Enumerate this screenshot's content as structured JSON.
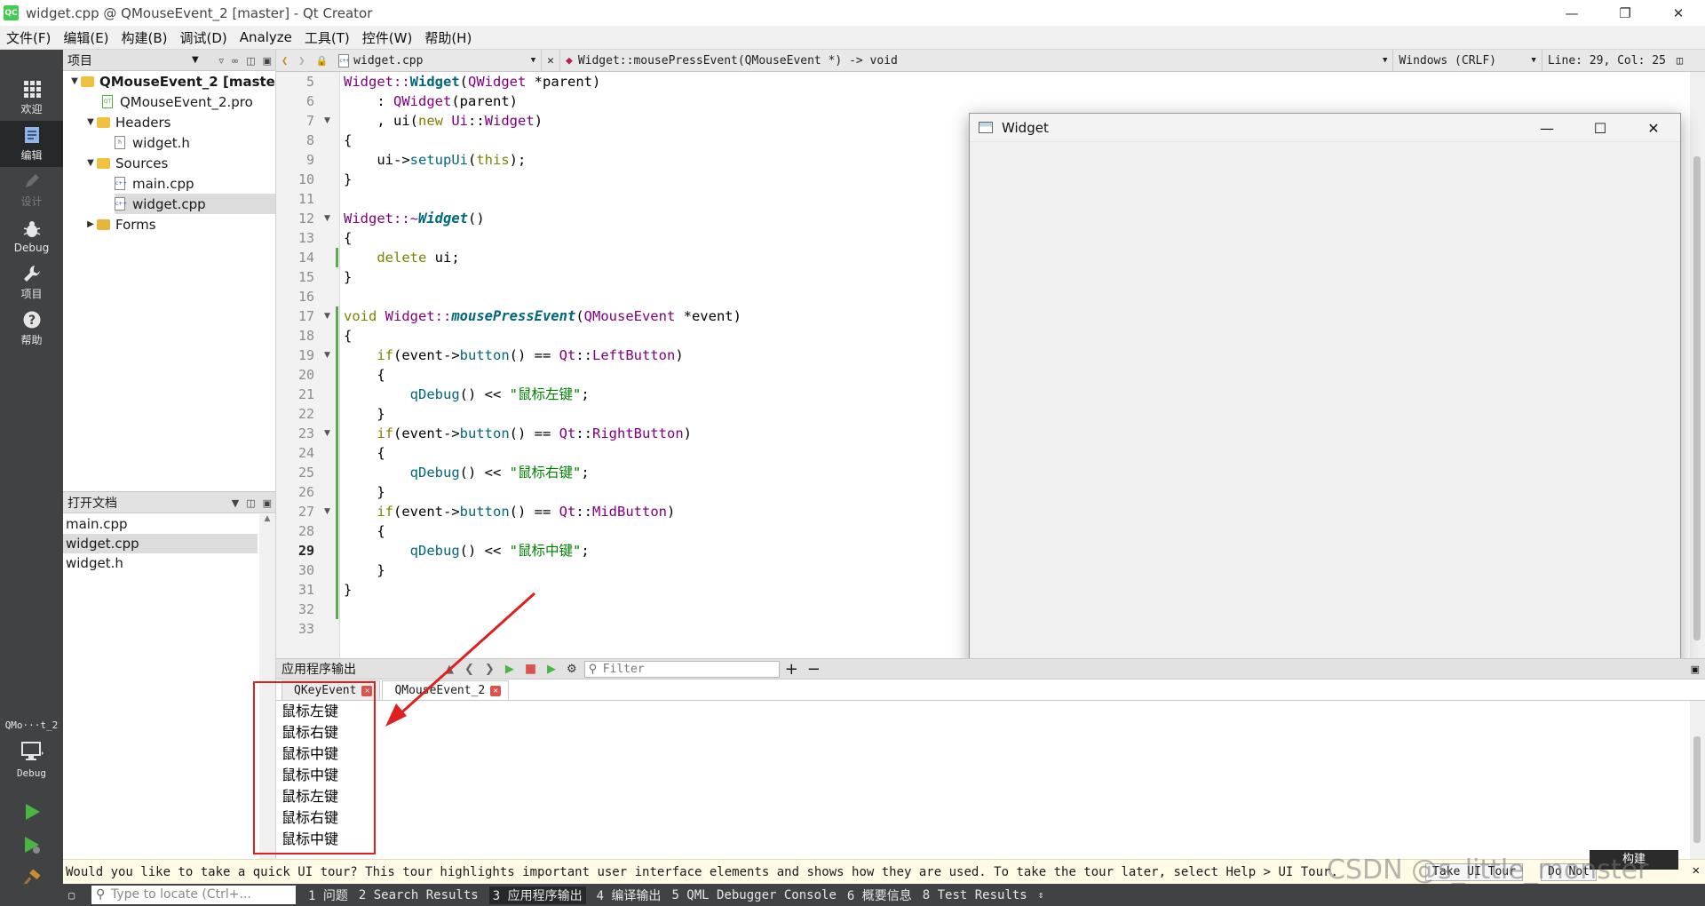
{
  "window": {
    "title": "widget.cpp @ QMouseEvent_2 [master] - Qt Creator",
    "logo": "QC"
  },
  "menu": [
    "文件(F)",
    "编辑(E)",
    "构建(B)",
    "调试(D)",
    "Analyze",
    "工具(T)",
    "控件(W)",
    "帮助(H)"
  ],
  "modes": [
    {
      "label": "欢迎",
      "icon": "grid-icon"
    },
    {
      "label": "编辑",
      "icon": "edit-icon"
    },
    {
      "label": "设计",
      "icon": "pencil-icon"
    },
    {
      "label": "Debug",
      "icon": "bug-icon"
    },
    {
      "label": "项目",
      "icon": "wrench-icon"
    },
    {
      "label": "帮助",
      "icon": "help-icon"
    }
  ],
  "run_target": {
    "name": "QMo···t_2",
    "mode": "Debug"
  },
  "project_panel": {
    "title": "项目",
    "tree": [
      {
        "label": "QMouseEvent_2 [master]",
        "kind": "project"
      },
      {
        "label": "QMouseEvent_2.pro",
        "kind": "pro"
      },
      {
        "label": "Headers",
        "kind": "folder"
      },
      {
        "label": "widget.h",
        "kind": "h"
      },
      {
        "label": "Sources",
        "kind": "folder"
      },
      {
        "label": "main.cpp",
        "kind": "cpp"
      },
      {
        "label": "widget.cpp",
        "kind": "cpp"
      },
      {
        "label": "Forms",
        "kind": "folder"
      }
    ]
  },
  "docs_panel": {
    "title": "打开文档",
    "items": [
      "main.cpp",
      "widget.cpp",
      "widget.h"
    ]
  },
  "editor_bar": {
    "file": "widget.cpp",
    "symbol": "Widget::mousePressEvent(QMouseEvent *) -> void",
    "encoding": "Windows (CRLF)",
    "position": "Line: 29, Col: 25"
  },
  "editor": {
    "line_numbers": [
      "5",
      "6",
      "7",
      "8",
      "9",
      "10",
      "11",
      "12",
      "13",
      "14",
      "15",
      "16",
      "17",
      "18",
      "19",
      "20",
      "21",
      "22",
      "23",
      "24",
      "25",
      "26",
      "27",
      "28",
      "29",
      "30",
      "31",
      "32",
      "33"
    ],
    "current_line": "29"
  },
  "code": {
    "l5_a": "Widget::",
    "l5_b": "Widget",
    "l5_c": "(",
    "l5_d": "QWidget",
    "l5_e": " *parent)",
    "l6_a": "    : ",
    "l6_b": "QWidget",
    "l6_c": "(parent)",
    "l7_a": "    , ui(",
    "l7_b": "new",
    "l7_c": " ",
    "l7_d": "Ui",
    "l7_e": "::",
    "l7_f": "Widget",
    "l7_g": ")",
    "l8": "{",
    "l9_a": "    ui->",
    "l9_b": "setupUi",
    "l9_c": "(",
    "l9_d": "this",
    "l9_e": ");",
    "l10": "}",
    "l12_a": "Widget::~",
    "l12_b": "Widget",
    "l12_c": "()",
    "l13": "{",
    "l14_a": "    ",
    "l14_b": "delete",
    "l14_c": " ui;",
    "l15": "}",
    "l17_a": "void",
    "l17_b": " Widget::",
    "l17_c": "mousePressEvent",
    "l17_d": "(",
    "l17_e": "QMouseEvent",
    "l17_f": " *event)",
    "l18": "{",
    "l19_a": "    ",
    "l19_b": "if",
    "l19_c": "(event->",
    "l19_d": "button",
    "l19_e": "() == ",
    "l19_f": "Qt",
    "l19_g": "::",
    "l19_h": "LeftButton",
    "l19_i": ")",
    "l20": "    {",
    "l21_a": "        ",
    "l21_b": "qDebug",
    "l21_c": "() << ",
    "l21_d": "\"鼠标左键\"",
    "l21_e": ";",
    "l22": "    }",
    "l23_a": "    ",
    "l23_b": "if",
    "l23_c": "(event->",
    "l23_d": "button",
    "l23_e": "() == ",
    "l23_f": "Qt",
    "l23_g": "::",
    "l23_h": "RightButton",
    "l23_i": ")",
    "l24": "    {",
    "l25_a": "        ",
    "l25_b": "qDebug",
    "l25_c": "() << ",
    "l25_d": "\"鼠标右键\"",
    "l25_e": ";",
    "l26": "    }",
    "l27_a": "    ",
    "l27_b": "if",
    "l27_c": "(event->",
    "l27_d": "button",
    "l27_e": "() == ",
    "l27_f": "Qt",
    "l27_g": "::",
    "l27_h": "MidButton",
    "l27_i": ")",
    "l28": "    {",
    "l29_a": "        ",
    "l29_b": "qDebug",
    "l29_c": "() << ",
    "l29_d": "\"鼠标中键\"",
    "l29_e": ";",
    "l30": "    }",
    "l31": "}"
  },
  "widget_window": {
    "title": "Widget"
  },
  "output": {
    "title": "应用程序输出",
    "filter_placeholder": "Filter",
    "tabs": [
      "QKeyEvent",
      "QMouseEvent_2"
    ],
    "lines": [
      "鼠标左键",
      "鼠标右键",
      "鼠标中键",
      "鼠标中键",
      "鼠标左键",
      "鼠标右键",
      "鼠标中键"
    ]
  },
  "infobar": {
    "message": "Would you like to take a quick UI tour? This tour highlights important user interface elements and shows how they are used. To take the tour later, select Help > UI Tour.",
    "take_tour": "Take UI Tour",
    "do_not": "Do Not",
    "build_popup": "构建"
  },
  "watermark": "CSDN @s_little_monster",
  "statusbar": {
    "locator_placeholder": "Type to locate (Ctrl+...",
    "panes": [
      "1 问题",
      "2 Search Results",
      "3 应用程序输出",
      "4 编译输出",
      "5 QML Debugger Console",
      "6 概要信息",
      "8 Test Results"
    ],
    "active_index": 2
  }
}
